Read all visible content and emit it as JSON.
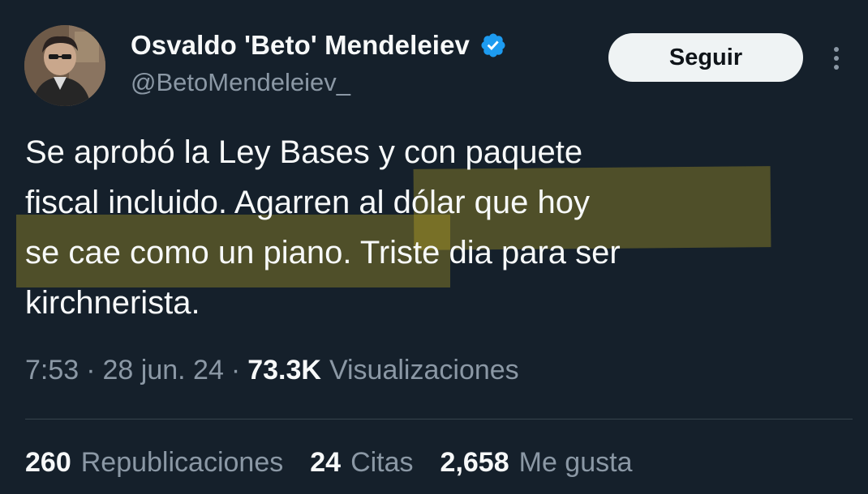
{
  "author": {
    "display_name": "Osvaldo 'Beto' Mendeleiev",
    "handle": "@BetoMendeleiev_",
    "verified_icon": "verified-badge-icon",
    "verified_color": "#1d9bf0"
  },
  "actions": {
    "follow_label": "Seguir",
    "more_icon": "more-vertical-icon"
  },
  "tweet": {
    "lines": [
      "Se aprobó la Ley Bases y con paquete",
      "fiscal incluido. Agarren al dólar que hoy",
      "se cae como un piano. Triste dia para ser",
      "kirchnerista."
    ],
    "highlight_color": "#d7be23"
  },
  "meta": {
    "time": "7:53",
    "separator": "·",
    "date": "28 jun. 24",
    "views_count": "73.3K",
    "views_label": "Visualizaciones"
  },
  "stats": {
    "reposts_count": "260",
    "reposts_label": "Republicaciones",
    "quotes_count": "24",
    "quotes_label": "Citas",
    "likes_count": "2,658",
    "likes_label": "Me gusta"
  },
  "colors": {
    "background": "#15202b",
    "text_primary": "#f7f9f9",
    "text_secondary": "#8b98a5",
    "button_bg": "#eff3f4",
    "divider": "#38444d"
  }
}
